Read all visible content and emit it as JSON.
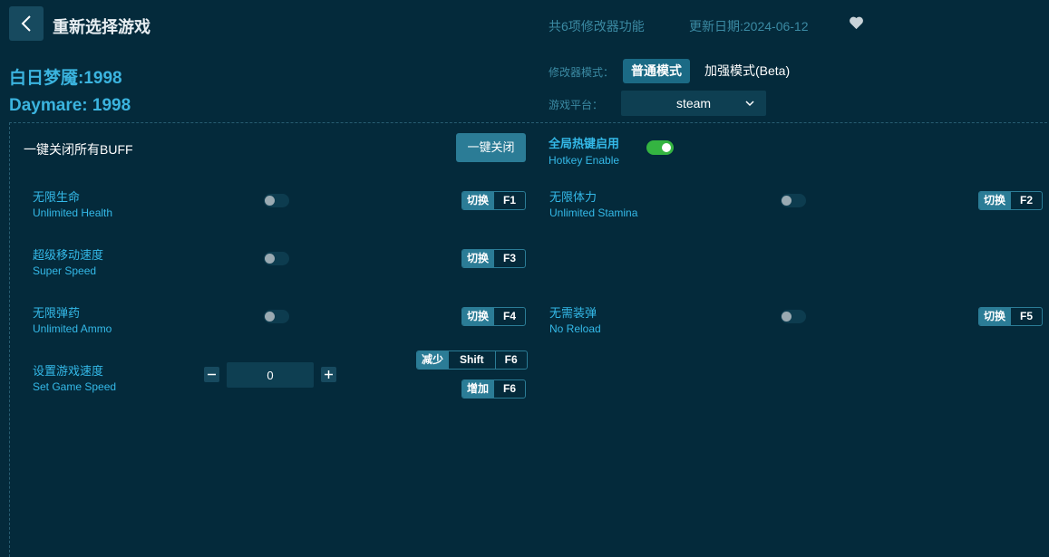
{
  "header": {
    "title": "重新选择游戏",
    "feature_count": "共6项修改器功能",
    "update_date": "更新日期:2024-06-12"
  },
  "game": {
    "title_zh": "白日梦魇:1998",
    "title_en": "Daymare: 1998"
  },
  "mode": {
    "label": "修改器模式：",
    "normal": "普通模式",
    "enhanced": "加强模式(Beta)",
    "selected": "普通模式"
  },
  "platform": {
    "label": "游戏平台：",
    "value": "steam"
  },
  "controls": {
    "close_all_label": "一键关闭所有BUFF",
    "close_all_button": "一键关闭",
    "hotkey_zh": "全局热键启用",
    "hotkey_en": "Hotkey Enable",
    "hotkey_enabled": true
  },
  "features": [
    {
      "zh": "无限生命",
      "en": "Unlimited Health",
      "switch_label": "切换",
      "key": "F1",
      "on": false
    },
    {
      "zh": "无限体力",
      "en": "Unlimited Stamina",
      "switch_label": "切换",
      "key": "F2",
      "on": false
    },
    {
      "zh": "超级移动速度",
      "en": "Super Speed",
      "switch_label": "切换",
      "key": "F3",
      "on": false
    },
    {
      "zh": "无限弹药",
      "en": "Unlimited Ammo",
      "switch_label": "切换",
      "key": "F4",
      "on": false
    },
    {
      "zh": "无需装弹",
      "en": "No Reload",
      "switch_label": "切换",
      "key": "F5",
      "on": false
    }
  ],
  "game_speed": {
    "zh": "设置游戏速度",
    "en": "Set Game Speed",
    "value": "0",
    "decrease_label": "减少",
    "decrease_mod": "Shift",
    "decrease_key": "F6",
    "increase_label": "增加",
    "increase_key": "F6"
  },
  "colors": {
    "background": "#042a3b",
    "accent": "#34b9e8",
    "button": "#2b7c96",
    "toggle_on": "#34b441"
  },
  "icons": {
    "back": "chevron-left-icon",
    "favorite": "heart-icon",
    "dropdown": "chevron-down-icon",
    "minus": "minus-icon",
    "plus": "plus-icon"
  }
}
